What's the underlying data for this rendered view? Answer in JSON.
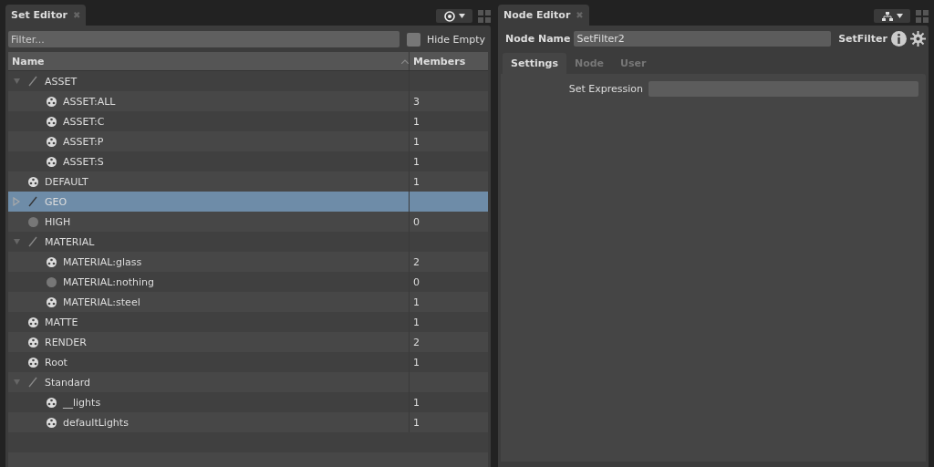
{
  "set_editor": {
    "tab": {
      "title": "Set Editor",
      "close": "✖"
    },
    "filter": {
      "placeholder": "Filter..."
    },
    "hide_empty": {
      "label": "Hide Empty",
      "checked": false
    },
    "columns": [
      "Name",
      "Members"
    ],
    "tree": [
      {
        "name": "ASSET",
        "kind": "group",
        "selected": false,
        "expanded": true,
        "children": [
          {
            "name": "ASSET:ALL",
            "kind": "set",
            "members": "3",
            "selected": false
          },
          {
            "name": "ASSET:C",
            "kind": "set",
            "members": "1",
            "selected": false
          },
          {
            "name": "ASSET:P",
            "kind": "set",
            "members": "1",
            "selected": false
          },
          {
            "name": "ASSET:S",
            "kind": "set",
            "members": "1",
            "selected": false
          }
        ]
      },
      {
        "name": "DEFAULT",
        "kind": "set",
        "members": "1",
        "selected": false
      },
      {
        "name": "GEO",
        "kind": "group",
        "selected": true,
        "expanded": false
      },
      {
        "name": "HIGH",
        "kind": "empty",
        "members": "0",
        "selected": false
      },
      {
        "name": "MATERIAL",
        "kind": "group",
        "selected": false,
        "expanded": true,
        "children": [
          {
            "name": "MATERIAL:glass",
            "kind": "set",
            "members": "2",
            "selected": false
          },
          {
            "name": "MATERIAL:nothing",
            "kind": "empty",
            "members": "0",
            "selected": false
          },
          {
            "name": "MATERIAL:steel",
            "kind": "set",
            "members": "1",
            "selected": false
          }
        ]
      },
      {
        "name": "MATTE",
        "kind": "set",
        "members": "1",
        "selected": false
      },
      {
        "name": "RENDER",
        "kind": "set",
        "members": "2",
        "selected": false
      },
      {
        "name": "Root",
        "kind": "set",
        "members": "1",
        "selected": false
      },
      {
        "name": "Standard",
        "kind": "group",
        "selected": false,
        "expanded": true,
        "children": [
          {
            "name": "__lights",
            "kind": "set",
            "members": "1",
            "selected": false
          },
          {
            "name": "defaultLights",
            "kind": "set",
            "members": "1",
            "selected": false
          }
        ]
      }
    ]
  },
  "node_editor": {
    "tab": {
      "title": "Node Editor",
      "close": "✖"
    },
    "node_name_label": "Node Name",
    "node_name": "SetFilter2",
    "node_type": "SetFilter",
    "tabs": [
      {
        "label": "Settings",
        "selected": true
      },
      {
        "label": "Node",
        "selected": false
      },
      {
        "label": "User",
        "selected": false
      }
    ],
    "fields": [
      {
        "label": "Set Expression"
      }
    ]
  }
}
